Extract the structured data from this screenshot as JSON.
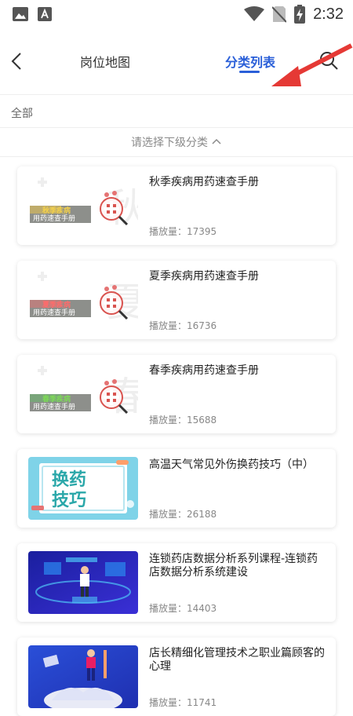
{
  "status": {
    "time": "2:32"
  },
  "header": {
    "tabs": [
      {
        "label": "岗位地图"
      },
      {
        "label": "分类列表"
      }
    ]
  },
  "filter": {
    "all_label": "全部",
    "subcategory_prompt": "请选择下级分类",
    "chevron": "^"
  },
  "plays_label": "播放量：",
  "courses": [
    {
      "title": "秋季疾病用药速查手册",
      "plays": "17395",
      "thumb_text": [
        "秋季疾病",
        "用药速查手册"
      ],
      "theme": "seasonal"
    },
    {
      "title": "夏季疾病用药速查手册",
      "plays": "16736",
      "thumb_text": [
        "夏季疾病",
        "用药速查手册"
      ],
      "theme": "seasonal"
    },
    {
      "title": "春季疾病用药速查手册",
      "plays": "15688",
      "thumb_text": [
        "春季疾病",
        "用药速查手册"
      ],
      "theme": "seasonal"
    },
    {
      "title": "高温天气常见外伤换药技巧（中）",
      "plays": "26188",
      "thumb_text": [
        "换药",
        "技巧"
      ],
      "theme": "blue-board"
    },
    {
      "title": "连锁药店数据分析系列课程-连锁药店数据分析系统建设",
      "plays": "14403",
      "thumb_text": [],
      "theme": "data"
    },
    {
      "title": "店长精细化管理技术之职业篇顾客的心理",
      "plays": "11741",
      "thumb_text": [],
      "theme": "manager"
    }
  ],
  "colors": {
    "accent": "#2a5fd8",
    "annotation": "#e53935"
  }
}
